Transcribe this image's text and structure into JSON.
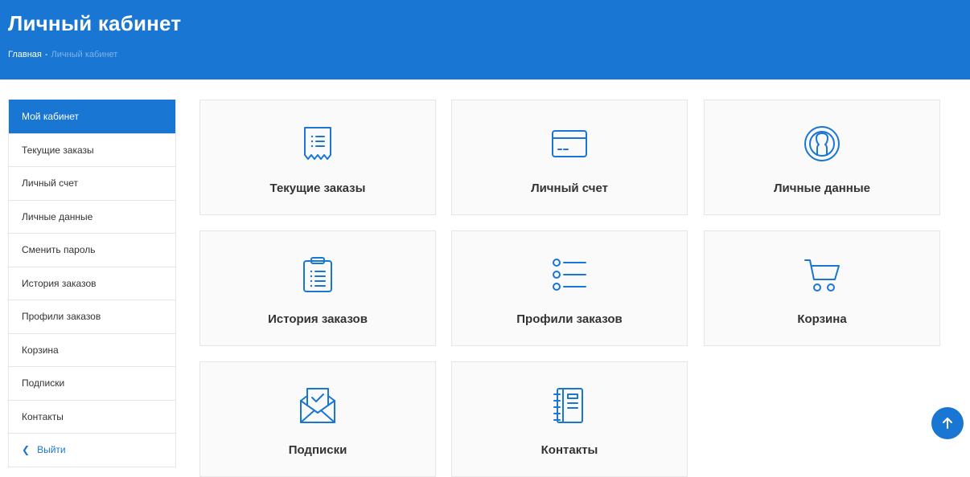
{
  "header": {
    "title": "Личный кабинет",
    "breadcrumb": {
      "home": "Главная",
      "separator": "-",
      "current": "Личный кабинет"
    }
  },
  "sidebar": {
    "items": [
      {
        "label": "Мой кабинет",
        "active": true
      },
      {
        "label": "Текущие заказы"
      },
      {
        "label": "Личный счет"
      },
      {
        "label": "Личные данные"
      },
      {
        "label": "Сменить пароль"
      },
      {
        "label": "История заказов"
      },
      {
        "label": "Профили заказов"
      },
      {
        "label": "Корзина"
      },
      {
        "label": "Подписки"
      },
      {
        "label": "Контакты"
      }
    ],
    "logout": {
      "label": "Выйти",
      "icon": "chevron-left-icon"
    }
  },
  "tiles": [
    {
      "label": "Текущие заказы",
      "icon": "receipt-list-icon"
    },
    {
      "label": "Личный счет",
      "icon": "credit-card-icon"
    },
    {
      "label": "Личные данные",
      "icon": "user-circle-icon"
    },
    {
      "label": "История заказов",
      "icon": "clipboard-list-icon"
    },
    {
      "label": "Профили заказов",
      "icon": "bullet-list-icon"
    },
    {
      "label": "Корзина",
      "icon": "shopping-cart-icon"
    },
    {
      "label": "Подписки",
      "icon": "envelope-check-icon"
    },
    {
      "label": "Контакты",
      "icon": "notebook-icon"
    }
  ],
  "scroll_top": {
    "icon": "arrow-up-icon"
  },
  "colors": {
    "accent": "#1976d2",
    "breadcrumb_current": "#7fb2ea",
    "tile_bg": "#fafafa",
    "border": "#e6e6e6",
    "text": "#333333"
  }
}
